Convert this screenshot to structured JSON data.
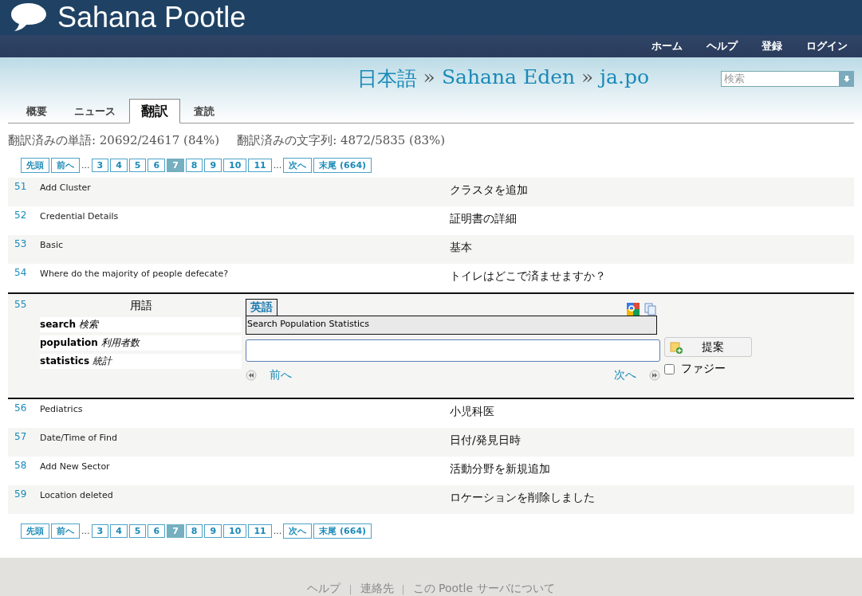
{
  "header": {
    "title": "Sahana Pootle",
    "nav": [
      "ホーム",
      "ヘルプ",
      "登録",
      "ログイン"
    ]
  },
  "breadcrumb": [
    {
      "label": "日本語",
      "kind": "link"
    },
    {
      "label": "»",
      "kind": "sep"
    },
    {
      "label": "Sahana Eden",
      "kind": "link"
    },
    {
      "label": "»",
      "kind": "sep"
    },
    {
      "label": "ja.po",
      "kind": "link"
    }
  ],
  "search": {
    "placeholder": "検索"
  },
  "tabs": [
    {
      "label": "概要",
      "selected": false
    },
    {
      "label": "ニュース",
      "selected": false
    },
    {
      "label": "翻訳",
      "selected": true
    },
    {
      "label": "査読",
      "selected": false
    }
  ],
  "stats": [
    "翻訳済みの単語: 20692/24617 (84%)",
    "翻訳済みの文字列: 4872/5835 (83%)"
  ],
  "pager_top": [
    {
      "label": "先頭",
      "kind": "link",
      "selected": false
    },
    {
      "label": "前へ",
      "kind": "link",
      "selected": false
    },
    {
      "label": "...",
      "kind": "ellipsis"
    },
    {
      "label": "3",
      "kind": "link",
      "selected": false
    },
    {
      "label": "4",
      "kind": "link",
      "selected": false
    },
    {
      "label": "5",
      "kind": "link",
      "selected": false
    },
    {
      "label": "6",
      "kind": "link",
      "selected": false
    },
    {
      "label": "7",
      "kind": "link",
      "selected": true
    },
    {
      "label": "8",
      "kind": "link",
      "selected": false
    },
    {
      "label": "9",
      "kind": "link",
      "selected": false
    },
    {
      "label": "10",
      "kind": "link",
      "selected": false
    },
    {
      "label": "11",
      "kind": "link",
      "selected": false
    },
    {
      "label": "...",
      "kind": "ellipsis"
    },
    {
      "label": "次へ",
      "kind": "link",
      "selected": false
    },
    {
      "label": "末尾 (664)",
      "kind": "link",
      "selected": false
    }
  ],
  "rows_before": [
    {
      "number": "51",
      "source": "Add Cluster",
      "target": "クラスタを追加"
    },
    {
      "number": "52",
      "source": "Credential Details",
      "target": "証明書の詳細"
    },
    {
      "number": "53",
      "source": "Basic",
      "target": "基本"
    },
    {
      "number": "54",
      "source": "Where do the majority of people defecate?",
      "target": "トイレはどこで済ませますか？"
    }
  ],
  "editor": {
    "number": "55",
    "glossary_title": "用語",
    "terms": [
      "**search** *検索*",
      "**population** *利用者数*",
      "**statistics** *統計*"
    ],
    "source_tab": "英語",
    "source_text": "Search Population Statistics",
    "prev": "前へ",
    "next": "次へ",
    "suggest": "提案",
    "fuzzy": {
      "label": "ファジー",
      "checked": false
    }
  },
  "rows_after": [
    {
      "number": "56",
      "source": "Pediatrics",
      "target": "小児科医"
    },
    {
      "number": "57",
      "source": "Date/Time of Find",
      "target": "日付/発見日時"
    },
    {
      "number": "58",
      "source": "Add New Sector",
      "target": "活動分野を新規追加"
    },
    {
      "number": "59",
      "source": "Location deleted",
      "target": "ロケーションを削除しました"
    }
  ],
  "pager_bottom": [
    {
      "label": "先頭",
      "kind": "link",
      "selected": false
    },
    {
      "label": "前へ",
      "kind": "link",
      "selected": false
    },
    {
      "label": "...",
      "kind": "ellipsis"
    },
    {
      "label": "3",
      "kind": "link",
      "selected": false
    },
    {
      "label": "4",
      "kind": "link",
      "selected": false
    },
    {
      "label": "5",
      "kind": "link",
      "selected": false
    },
    {
      "label": "6",
      "kind": "link",
      "selected": false
    },
    {
      "label": "7",
      "kind": "link",
      "selected": true
    },
    {
      "label": "8",
      "kind": "link",
      "selected": false
    },
    {
      "label": "9",
      "kind": "link",
      "selected": false
    },
    {
      "label": "10",
      "kind": "link",
      "selected": false
    },
    {
      "label": "11",
      "kind": "link",
      "selected": false
    },
    {
      "label": "...",
      "kind": "ellipsis"
    },
    {
      "label": "次へ",
      "kind": "link",
      "selected": false
    },
    {
      "label": "末尾 (664)",
      "kind": "link",
      "selected": false
    }
  ],
  "footer": [
    {
      "label": "ヘルプ",
      "kind": "link"
    },
    {
      "label": "|",
      "kind": "sep"
    },
    {
      "label": "連絡先",
      "kind": "link"
    },
    {
      "label": "|",
      "kind": "sep"
    },
    {
      "label": "この Pootle サーバについて",
      "kind": "link"
    }
  ]
}
